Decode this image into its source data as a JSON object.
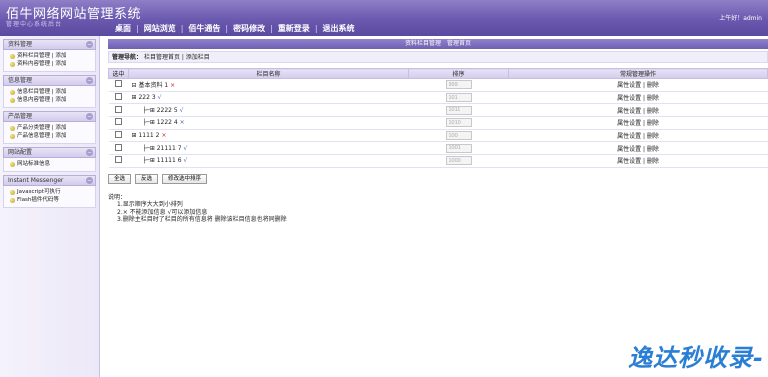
{
  "header": {
    "title": "佰牛网络网站管理系统",
    "subtitle": "管理中心系统后台",
    "user": "上午好！admin",
    "nav": [
      "桌面",
      "网站浏览",
      "佰牛通告",
      "密码修改",
      "重新登录",
      "退出系统"
    ]
  },
  "sidebar": {
    "groups": [
      {
        "title": "资料管理",
        "links": [
          "资料栏目管理 | 添加",
          "资料内容管理 | 添加"
        ]
      },
      {
        "title": "信息管理",
        "links": [
          "信息栏目管理 | 添加",
          "信息内容管理 | 添加"
        ]
      },
      {
        "title": "产品管理",
        "links": [
          "产品分类管理 | 添加",
          "产品信息管理 | 添加"
        ]
      },
      {
        "title": "网站配置",
        "links": [
          "网站标准信息"
        ]
      },
      {
        "title": "Instant Messenger",
        "links": [
          "Javascript可执行",
          "Flash插件代码等"
        ]
      }
    ]
  },
  "main": {
    "title": "资料栏目管理　管理首页",
    "crumb_label": "管理导航：",
    "crumb_text": "栏目管理首页 | 添加栏目",
    "columns": [
      "选中",
      "栏目名称",
      "排序",
      "常规管理操作"
    ],
    "rows": [
      {
        "prefix": "⊟",
        "name": "基本资料",
        "count": "1",
        "mark": "×",
        "mark_color": "red",
        "sort": "999",
        "ops": "属性设置 | 删除"
      },
      {
        "prefix": "⊞",
        "name": "222",
        "count": "3",
        "mark": "√",
        "mark_color": "blue",
        "sort": "101",
        "ops": "属性设置 | 删除"
      },
      {
        "prefix": "├─⊞",
        "name": "2222",
        "count": "5",
        "mark": "√",
        "mark_color": "blue",
        "sort": "1011",
        "ops": "属性设置 | 删除"
      },
      {
        "prefix": "├─⊞",
        "name": "1222",
        "count": "4",
        "mark": "×",
        "mark_color": "blue",
        "sort": "1010",
        "ops": "属性设置 | 删除"
      },
      {
        "prefix": "⊞",
        "name": "1111",
        "count": "2",
        "mark": "×",
        "mark_color": "red",
        "sort": "100",
        "ops": "属性设置 | 删除"
      },
      {
        "prefix": "├─⊞",
        "name": "21111",
        "count": "7",
        "mark": "√",
        "mark_color": "blue",
        "sort": "1001",
        "ops": "属性设置 | 删除"
      },
      {
        "prefix": "├─⊞",
        "name": "11111",
        "count": "6",
        "mark": "√",
        "mark_color": "blue",
        "sort": "1000",
        "ops": "属性设置 | 删除"
      }
    ],
    "buttons": [
      "全选",
      "反选",
      "修改选中排序"
    ],
    "notes_title": "说明：",
    "notes": [
      "1.显示顺序大大到小排列",
      "2.× 不能添加信息 √可以添加信息",
      "3.删除主栏目时了栏目的所有信息将 删除该栏目信息也将同删除"
    ]
  },
  "watermark": "逸达秒收录-"
}
